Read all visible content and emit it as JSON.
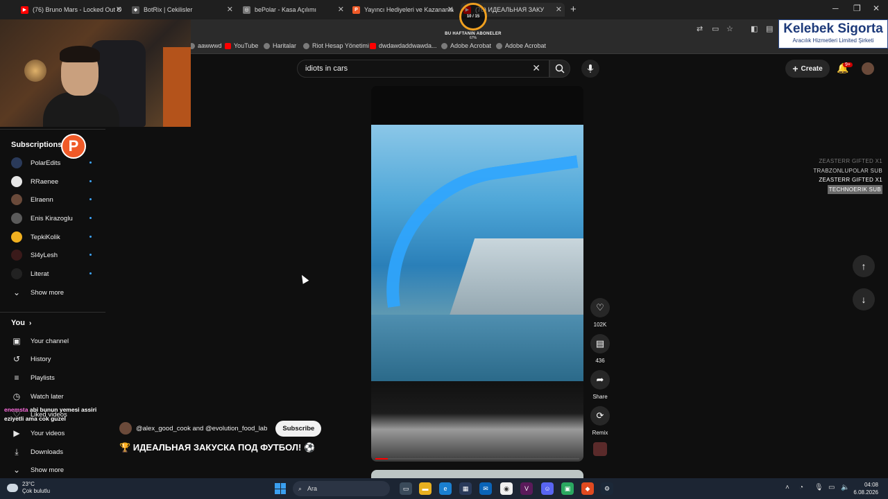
{
  "tabs": [
    {
      "label": "(76) Bruno Mars - Locked Out O",
      "fav_color": "#ff0000",
      "fav": "▶"
    },
    {
      "label": "BotRix | Cekilisler",
      "fav_color": "#555555",
      "fav": "◆"
    },
    {
      "label": "bePolar - Kasa Açılımı",
      "fav_color": "#777777",
      "fav": "◎"
    },
    {
      "label": "Yayıncı Hediyeleri ve Kazananla",
      "fav_color": "#f05a28",
      "fav": "P"
    },
    {
      "label": "(76) ИДЕАЛЬНАЯ ЗАКУ",
      "fav_color": "#ff0000",
      "fav": "▶"
    }
  ],
  "bookmarks": [
    {
      "label": "aawwwd",
      "type": "plain"
    },
    {
      "label": "YouTube",
      "type": "yt"
    },
    {
      "label": "Haritalar",
      "type": "plain"
    },
    {
      "label": "Riot Hesap Yönetimi",
      "type": "plain"
    },
    {
      "label": "dwdawdaddwawda...",
      "type": "yt"
    },
    {
      "label": "Adobe Acrobat",
      "type": "plain"
    },
    {
      "label": "Adobe Acrobat",
      "type": "plain"
    }
  ],
  "overlay": {
    "sub_goal_count": "10 / 15",
    "sub_goal_label": "BU HAFTANIN ABONELER",
    "sub_goal_pct": "67%",
    "logo_title": "Kelebek Sigorta",
    "logo_sub": "Aracılık Hizmetleri Limited Şirketi",
    "gifts": [
      "ZEASTERR GIFTED X1",
      "TRABZONLUPOLAR SUB",
      "ZEASTERR GIFTED X1",
      "TECHNOERIK SUB"
    ],
    "chat_user": "enemsta",
    "chat_message": "abi bunun yemesi assiri eziyetli ama cok guzel"
  },
  "search": {
    "query": "idiots in cars"
  },
  "header": {
    "create_label": "Create",
    "notif_badge": "9+"
  },
  "sidebar": {
    "subscriptions_title": "Subscriptions",
    "subscriptions": [
      {
        "name": "PolarEdits",
        "color": "#2a3a5a"
      },
      {
        "name": "RRaenee",
        "color": "#e6e6e6"
      },
      {
        "name": "Elraenn",
        "color": "#6a4a3a"
      },
      {
        "name": "Enis Kirazoglu",
        "color": "#5a5a5a"
      },
      {
        "name": "TepkiKolik",
        "color": "#f0b020"
      },
      {
        "name": "Sl4yLesh",
        "color": "#3a1a1a"
      },
      {
        "name": "Literat",
        "color": "#222222"
      }
    ],
    "show_more_1": "Show more",
    "you_title": "You",
    "you_items": [
      {
        "label": "Your channel",
        "icon": "channel-icon",
        "glyph": "▣"
      },
      {
        "label": "History",
        "icon": "history-icon",
        "glyph": "↺"
      },
      {
        "label": "Playlists",
        "icon": "playlists-icon",
        "glyph": "≡"
      },
      {
        "label": "Watch later",
        "icon": "clock-icon",
        "glyph": "◷"
      },
      {
        "label": "Liked videos",
        "icon": "like-icon",
        "glyph": "👍"
      },
      {
        "label": "Your videos",
        "icon": "video-icon",
        "glyph": "▶"
      },
      {
        "label": "Downloads",
        "icon": "download-icon",
        "glyph": "⤓"
      }
    ],
    "show_more_2": "Show more"
  },
  "short": {
    "likes": "102K",
    "comments": "436",
    "share_label": "Share",
    "remix_label": "Remix",
    "channel_line": "@alex_good_cook and @evolution_food_lab",
    "subscribe_label": "Subscribe",
    "title": "🏆 ИДЕАЛЬНАЯ ЗАКУСКА ПОД ФУТБОЛ! ⚽",
    "progress": 0.06
  },
  "taskbar": {
    "temp": "23°C",
    "weather": "Çok bulutlu",
    "search_placeholder": "Ara",
    "time": "04:08",
    "date": "6.08.2026"
  }
}
